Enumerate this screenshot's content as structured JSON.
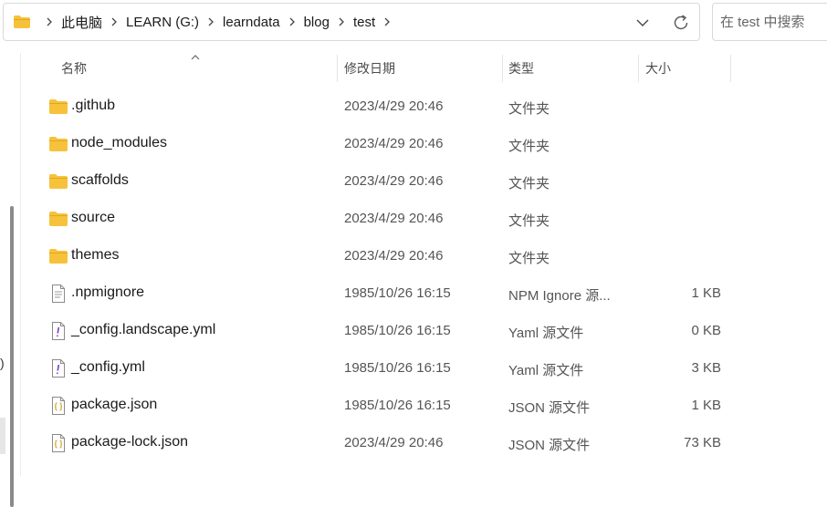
{
  "address_bar": {
    "folder_icon": "folder-icon",
    "breadcrumbs": [
      "此电脑",
      "LEARN (G:)",
      "learndata",
      "blog",
      "test"
    ],
    "separator_icon": "chevron-right-icon",
    "dropdown_icon": "chevron-down-icon",
    "refresh_icon": "refresh-icon"
  },
  "search": {
    "placeholder": "在 test 中搜索"
  },
  "nav_pane": {
    "cut_text": ")"
  },
  "columns": {
    "name": "名称",
    "modified": "修改日期",
    "type": "类型",
    "size": "大小"
  },
  "colors": {
    "folder": "#f7c23b",
    "json_icon": "#c9a227",
    "yaml_icon": "#7b3fbf"
  },
  "files": [
    {
      "icon": "folder-icon",
      "name": ".github",
      "modified": "2023/4/29 20:46",
      "type": "文件夹",
      "size": ""
    },
    {
      "icon": "folder-icon",
      "name": "node_modules",
      "modified": "2023/4/29 20:46",
      "type": "文件夹",
      "size": ""
    },
    {
      "icon": "folder-icon",
      "name": "scaffolds",
      "modified": "2023/4/29 20:46",
      "type": "文件夹",
      "size": ""
    },
    {
      "icon": "folder-icon",
      "name": "source",
      "modified": "2023/4/29 20:46",
      "type": "文件夹",
      "size": ""
    },
    {
      "icon": "folder-icon",
      "name": "themes",
      "modified": "2023/4/29 20:46",
      "type": "文件夹",
      "size": ""
    },
    {
      "icon": "text-file-icon",
      "name": ".npmignore",
      "modified": "1985/10/26 16:15",
      "type": "NPM Ignore 源...",
      "size": "1 KB"
    },
    {
      "icon": "yaml-file-icon",
      "name": "_config.landscape.yml",
      "modified": "1985/10/26 16:15",
      "type": "Yaml 源文件",
      "size": "0 KB"
    },
    {
      "icon": "yaml-file-icon",
      "name": "_config.yml",
      "modified": "1985/10/26 16:15",
      "type": "Yaml 源文件",
      "size": "3 KB"
    },
    {
      "icon": "json-file-icon",
      "name": "package.json",
      "modified": "1985/10/26 16:15",
      "type": "JSON 源文件",
      "size": "1 KB"
    },
    {
      "icon": "json-file-icon",
      "name": "package-lock.json",
      "modified": "2023/4/29 20:46",
      "type": "JSON 源文件",
      "size": "73 KB"
    }
  ]
}
